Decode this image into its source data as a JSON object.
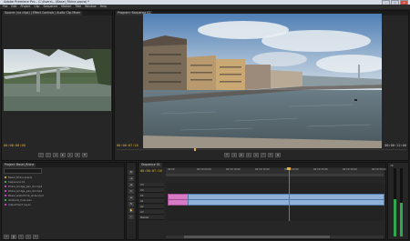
{
  "window": {
    "title": "Adobe Premiere Pro - C:\\Users\\...\\Basel_Rhine.prproj *",
    "buttons": [
      "–",
      "▢",
      "✕"
    ]
  },
  "menu": [
    "File",
    "Edit",
    "Project",
    "Clip",
    "Sequence",
    "Marker",
    "Title",
    "Window",
    "Help"
  ],
  "source_monitor": {
    "tab": "Source: (no clips) | Effect Controls | Audio Clip Mixer",
    "timecode": "00:00:00:00"
  },
  "program_monitor": {
    "tab": "Program: Sequence 01",
    "timecode_left": "00:00:07:16",
    "timecode_right": "00:00:12:06"
  },
  "project_panel": {
    "tab": "Project: Basel_Rhine",
    "rows": [
      {
        "name": "Basel_Rhine.prproj",
        "color": "#c9a227"
      },
      {
        "name": "Sequence 01",
        "color": "#3fa34d"
      },
      {
        "name": "Rhine_bridge_pan_01.mp4",
        "color": "#c33fbf"
      },
      {
        "name": "Rhine_bridge_pan_02.mp4",
        "color": "#c33fbf"
      },
      {
        "name": "Basel_waterfront_wide.mp4",
        "color": "#c33fbf"
      },
      {
        "name": "Ambient_river.wav",
        "color": "#3fa34d"
      },
      {
        "name": "Adjustment Layer",
        "color": "#c33fbf"
      }
    ]
  },
  "timeline": {
    "tab": "Sequence 01",
    "timecode": "00:00:07:16",
    "ruler": [
      "00:00",
      "00:00:05:00",
      "00:00:10:00",
      "00:00:15:00",
      "00:00:20:00",
      "00:00:25:00",
      "00:00:30:00",
      "00:00:35:00"
    ],
    "tracks": [
      "V3",
      "V2",
      "V1",
      "A1",
      "A2",
      "A3",
      "Master"
    ]
  },
  "meter": {
    "label": "dB",
    "level_left": 0.55,
    "level_right": 0.5
  }
}
